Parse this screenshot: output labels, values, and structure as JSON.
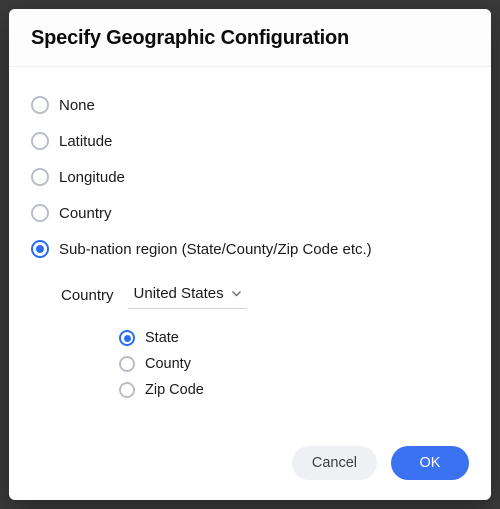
{
  "dialog": {
    "title": "Specify Geographic Configuration"
  },
  "options": {
    "none": {
      "label": "None",
      "selected": false
    },
    "latitude": {
      "label": "Latitude",
      "selected": false
    },
    "longitude": {
      "label": "Longitude",
      "selected": false
    },
    "country": {
      "label": "Country",
      "selected": false
    },
    "subnation": {
      "label": "Sub-nation region (State/County/Zip Code etc.)",
      "selected": true
    }
  },
  "subnation": {
    "country_label": "Country",
    "country_value": "United States",
    "levels": {
      "state": {
        "label": "State",
        "selected": true
      },
      "county": {
        "label": "County",
        "selected": false
      },
      "zip": {
        "label": "Zip Code",
        "selected": false
      }
    }
  },
  "footer": {
    "cancel": "Cancel",
    "ok": "OK"
  }
}
